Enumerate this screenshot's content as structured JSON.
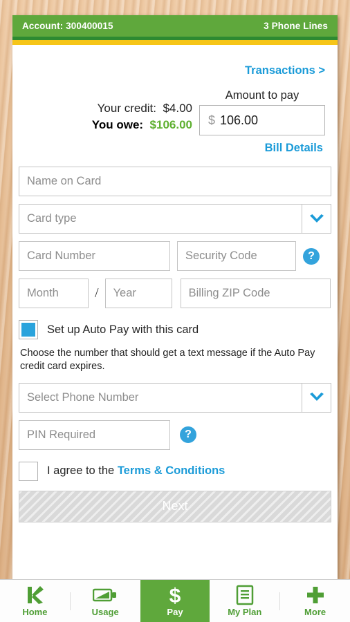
{
  "header": {
    "account_label": "Account: 300400015",
    "lines_label": "3 Phone Lines",
    "bar_color": "#5fa83c",
    "accent_gold": "#f6c518"
  },
  "links": {
    "transactions": "Transactions >",
    "bill_details": "Bill Details",
    "terms": "Terms & Conditions",
    "link_color": "#1b9bd8"
  },
  "balance": {
    "credit_label": "Your credit:",
    "credit_value": "$4.00",
    "owe_label": "You owe:",
    "owe_value": "$106.00",
    "owe_color": "#5fb031"
  },
  "amount_to_pay": {
    "caption": "Amount to pay",
    "currency": "$",
    "value": "106.00"
  },
  "form": {
    "name_on_card_placeholder": "Name on Card",
    "card_type_placeholder": "Card type",
    "card_number_placeholder": "Card Number",
    "security_code_placeholder": "Security Code",
    "month_placeholder": "Month",
    "separator": "/",
    "year_placeholder": "Year",
    "billing_zip_placeholder": "Billing ZIP Code",
    "security_help": "?",
    "pin_help": "?"
  },
  "autopay": {
    "checkbox_label": "Set up Auto Pay with this card",
    "checked": true,
    "note": "Choose the number that should get a text message if the Auto Pay credit card expires.",
    "phone_placeholder": "Select Phone Number",
    "pin_placeholder": "PIN Required",
    "checked_color": "#2aa3dc"
  },
  "agreement": {
    "prefix": "I agree to the ",
    "link": "Terms & Conditions",
    "checked": false
  },
  "submit": {
    "label": "Next",
    "enabled": false
  },
  "tabbar": {
    "items": [
      {
        "label": "Home",
        "icon": "k-logo-icon",
        "active": false
      },
      {
        "label": "Usage",
        "icon": "battery-icon",
        "active": false
      },
      {
        "label": "Pay",
        "icon": "dollar-icon",
        "active": true
      },
      {
        "label": "My Plan",
        "icon": "document-icon",
        "active": false
      },
      {
        "label": "More",
        "icon": "plus-icon",
        "active": false
      }
    ],
    "active_bg": "#5fa83c",
    "icon_color": "#4f9e35"
  }
}
